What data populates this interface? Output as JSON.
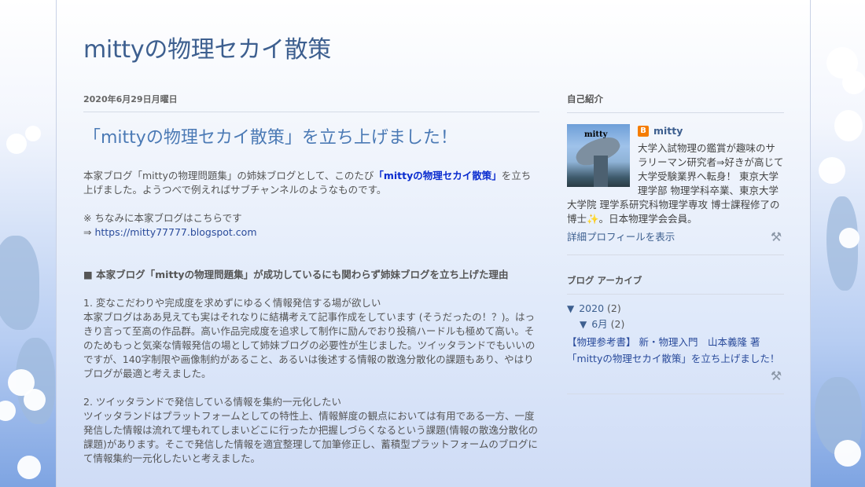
{
  "blog": {
    "title": "mittyの物理セカイ散策"
  },
  "post": {
    "date": "2020年6月29日月曜日",
    "title": "「mittyの物理セカイ散策」を立ち上げました！",
    "intro_prefix": "本家ブログ「mittyの物理問題集」の姉妹ブログとして、このたび",
    "intro_link": "「mittyの物理セカイ散策」",
    "intro_suffix": "を立ち上げました。ようつべで例えればサブチャンネルのようなものです。",
    "note": "※ ちなみに本家ブログはこちらです",
    "arrow": "⇒ ",
    "home_url": "https://mitty77777.blogspot.com",
    "section_heading": "■ 本家ブログ「mittyの物理問題集」が成功しているにも関わらず姉妹ブログを立ち上げた理由",
    "reason1_title": "1. 変なこだわりや完成度を求めずにゆるく情報発信する場が欲しい",
    "reason1_body": "本家ブログはああ見えても実はそれなりに結構考えて記事作成をしています (そうだったの！？)。はっきり言って至高の作品群。高い作品完成度を追求して制作に励んでおり投稿ハードルも極めて高い。そのためもっと気楽な情報発信の場として姉妹ブログの必要性が生じました。ツイッタランドでもいいのですが、140字制限や画像制約があること、あるいは後述する情報の散逸分散化の課題もあり、やはりブログが最適と考えました。",
    "reason2_title": "2. ツイッタランドで発信している情報を集約一元化したい",
    "reason2_body": "ツイッタランドはプラットフォームとしての特性上、情報鮮度の観点においては有用である一方、一度発信した情報は流れて埋もれてしまいどこに行ったか把握しづらくなるという課題(情報の散逸分散化の課題)があります。そこで発信した情報を適宜整理して加筆修正し、蓄積型プラットフォームのブログにて情報集約一元化したいと考えました。"
  },
  "sidebar": {
    "profile": {
      "heading": "自己紹介",
      "image_caption": "mitty",
      "name": "mitty",
      "bio": "大学入試物理の鑑賞が趣味のサラリーマン研究者⇒好きが高じて大学受験業界へ転身！ 東京大学 理学部 物理学科卒業、東京大学大学院 理学系研究科物理学専攻 博士課程修了の博士✨。日本物理学会会員。",
      "detail_link": "詳細プロフィールを表示"
    },
    "archive": {
      "heading": "ブログ アーカイブ",
      "year_toggle": "▼",
      "year_label": "2020",
      "year_count": "(2)",
      "month_toggle": "▼",
      "month_label": "6月",
      "month_count": "(2)",
      "posts": [
        "【物理参考書】 新・物理入門　山本義隆 著",
        "「mittyの物理セカイ散策」を立ち上げました！"
      ]
    }
  },
  "icons": {
    "blogger": "B",
    "tools": "⚒"
  },
  "colors": {
    "title": "#3d5f8f",
    "post_title": "#4b7ab5",
    "link_emphasis": "#0a2ccf",
    "blogger_orange": "#f57d00"
  }
}
